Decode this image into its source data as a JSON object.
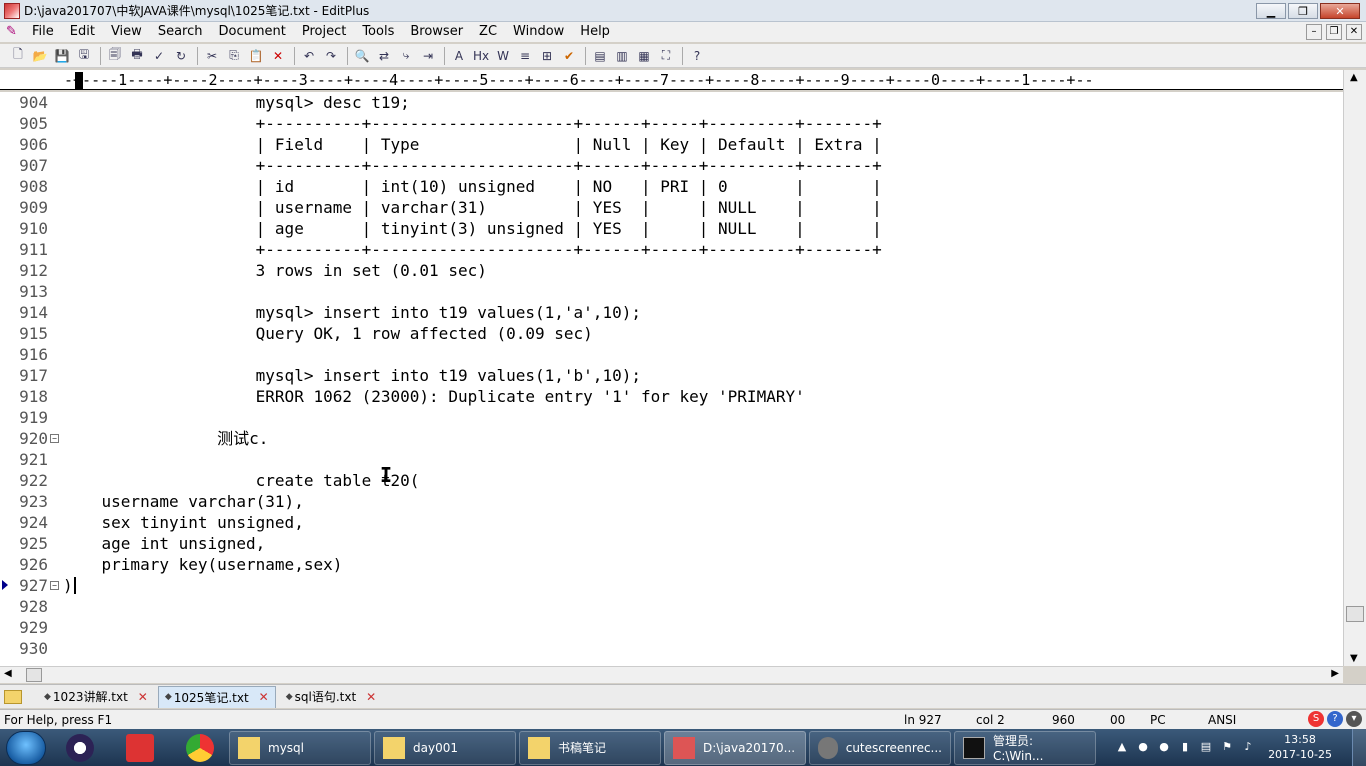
{
  "window": {
    "title": "D:\\java201707\\中软JAVA课件\\mysql\\1025笔记.txt - EditPlus",
    "minimize": "▁",
    "restore": "❐",
    "close": "✕"
  },
  "menu": {
    "items": [
      "File",
      "Edit",
      "View",
      "Search",
      "Document",
      "Project",
      "Tools",
      "Browser",
      "ZC",
      "Window",
      "Help"
    ]
  },
  "ruler": {
    "text": "-+----1----+----2----+----3----+----4----+----5----+----6----+----7----+----8----+----9----+----0----+----1----+--"
  },
  "editor": {
    "lines": [
      {
        "num": "904",
        "text": "                    mysql> desc t19;"
      },
      {
        "num": "905",
        "text": "                    +----------+---------------------+------+-----+---------+-------+"
      },
      {
        "num": "906",
        "text": "                    | Field    | Type                | Null | Key | Default | Extra |"
      },
      {
        "num": "907",
        "text": "                    +----------+---------------------+------+-----+---------+-------+"
      },
      {
        "num": "908",
        "text": "                    | id       | int(10) unsigned    | NO   | PRI | 0       |       |"
      },
      {
        "num": "909",
        "text": "                    | username | varchar(31)         | YES  |     | NULL    |       |"
      },
      {
        "num": "910",
        "text": "                    | age      | tinyint(3) unsigned | YES  |     | NULL    |       |"
      },
      {
        "num": "911",
        "text": "                    +----------+---------------------+------+-----+---------+-------+"
      },
      {
        "num": "912",
        "text": "                    3 rows in set (0.01 sec)"
      },
      {
        "num": "913",
        "text": ""
      },
      {
        "num": "914",
        "text": "                    mysql> insert into t19 values(1,'a',10);"
      },
      {
        "num": "915",
        "text": "                    Query OK, 1 row affected (0.09 sec)"
      },
      {
        "num": "916",
        "text": ""
      },
      {
        "num": "917",
        "text": "                    mysql> insert into t19 values(1,'b',10);"
      },
      {
        "num": "918",
        "text": "                    ERROR 1062 (23000): Duplicate entry '1' for key 'PRIMARY'"
      },
      {
        "num": "919",
        "text": ""
      },
      {
        "num": "920",
        "text": "                测试c."
      },
      {
        "num": "921",
        "text": ""
      },
      {
        "num": "922",
        "text": "                    create table t20("
      },
      {
        "num": "923",
        "text": "    username varchar(31),"
      },
      {
        "num": "924",
        "text": "    sex tinyint unsigned,"
      },
      {
        "num": "925",
        "text": "    age int unsigned,"
      },
      {
        "num": "926",
        "text": "    primary key(username,sex)"
      },
      {
        "num": "927",
        "text": ")"
      },
      {
        "num": "928",
        "text": ""
      },
      {
        "num": "929",
        "text": ""
      },
      {
        "num": "930",
        "text": ""
      }
    ]
  },
  "tabs": [
    {
      "label": "1023讲解.txt",
      "close": "✕"
    },
    {
      "label": "1025笔记.txt",
      "close": "✕"
    },
    {
      "label": "sql语句.txt",
      "close": "✕"
    }
  ],
  "status": {
    "help": "For Help, press F1",
    "line": "ln 927",
    "col": "col 2",
    "num1": "960",
    "num2": "00",
    "mode": "PC",
    "encoding": "ANSI"
  },
  "taskbar": {
    "tasks": [
      "mysql",
      "day001",
      "书稿笔记",
      "D:\\java20170...",
      "cutescreenrec...",
      "管理员: C:\\Win..."
    ],
    "time": "13:58",
    "date": "2017-10-25"
  }
}
